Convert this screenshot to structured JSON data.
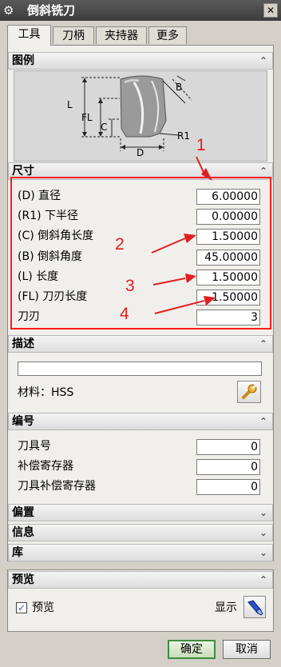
{
  "window": {
    "title": "倒斜铣刀",
    "close_glyph": "✕"
  },
  "tabs": [
    "工具",
    "刀柄",
    "夹持器",
    "更多"
  ],
  "sections": {
    "figure": {
      "label": "图例"
    },
    "dimensions": {
      "label": "尺寸",
      "fields": [
        {
          "label": "(D) 直径",
          "value": "6.00000"
        },
        {
          "label": "(R1) 下半径",
          "value": "0.00000"
        },
        {
          "label": "(C) 倒斜角长度",
          "value": "1.50000"
        },
        {
          "label": "(B) 倒斜角度",
          "value": "45.00000"
        },
        {
          "label": "(L) 长度",
          "value": "1.50000"
        },
        {
          "label": "(FL) 刀刃长度",
          "value": "1.50000"
        },
        {
          "label": "刀刃",
          "value": "3"
        }
      ]
    },
    "description": {
      "label": "描述",
      "input_value": "",
      "material_label": "材料：HSS"
    },
    "numbering": {
      "label": "编号",
      "fields": [
        {
          "label": "刀具号",
          "value": "0"
        },
        {
          "label": "补偿寄存器",
          "value": "0"
        },
        {
          "label": "刀具补偿寄存器",
          "value": "0"
        }
      ]
    },
    "offset": {
      "label": "偏置"
    },
    "info": {
      "label": "信息"
    },
    "library": {
      "label": "库"
    },
    "preview": {
      "label": "预览",
      "checkbox_label": "预览",
      "checked": true,
      "show_label": "显示"
    }
  },
  "diagram_labels": {
    "B": "B",
    "L": "L",
    "FL": "FL",
    "C": "C",
    "D": "D",
    "R1": "R1"
  },
  "annotations": [
    "1",
    "2",
    "3",
    "4"
  ],
  "buttons": {
    "ok": "确定",
    "cancel": "取消"
  },
  "colors": {
    "annotation": "#e02020",
    "titlebar": "#444444"
  }
}
